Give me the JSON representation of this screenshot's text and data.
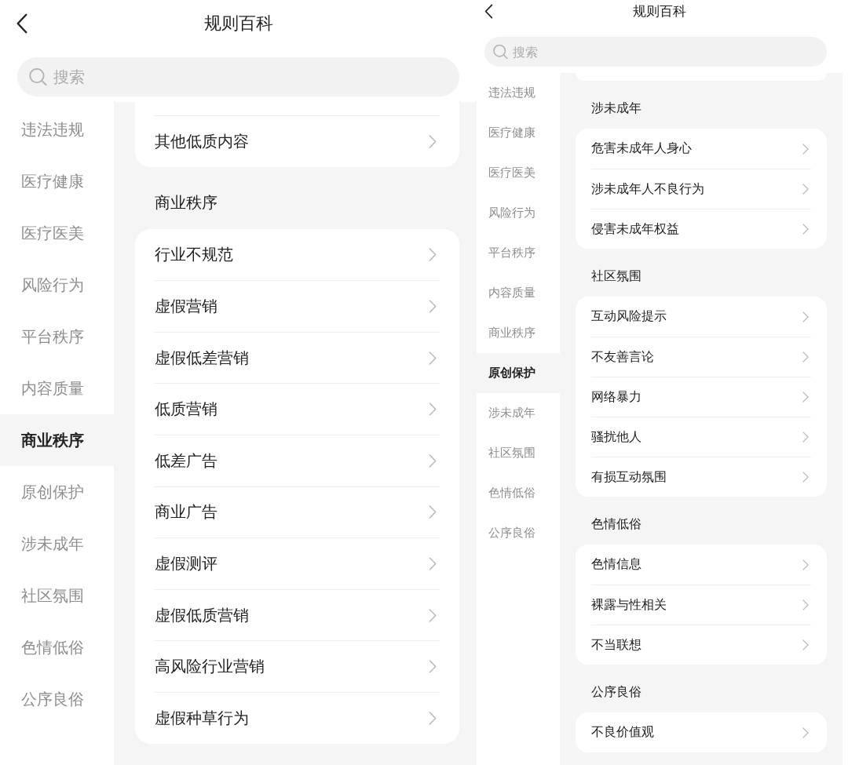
{
  "screens": [
    {
      "header": {
        "title": "规则百科"
      },
      "search": {
        "placeholder": "搜索"
      },
      "sidebar": {
        "items": [
          {
            "label": "违法违规",
            "selected": false
          },
          {
            "label": "医疗健康",
            "selected": false
          },
          {
            "label": "医疗医美",
            "selected": false
          },
          {
            "label": "风险行为",
            "selected": false
          },
          {
            "label": "平台秩序",
            "selected": false
          },
          {
            "label": "内容质量",
            "selected": false
          },
          {
            "label": "商业秩序",
            "selected": true
          },
          {
            "label": "原创保护",
            "selected": false
          },
          {
            "label": "涉未成年",
            "selected": false
          },
          {
            "label": "社区氛围",
            "selected": false
          },
          {
            "label": "色情低俗",
            "selected": false
          },
          {
            "label": "公序良俗",
            "selected": false
          }
        ]
      },
      "content": {
        "sections": [
          {
            "clipped": true,
            "items": [
              {
                "label": "其他低质内容"
              }
            ]
          },
          {
            "clipped": false,
            "title": "商业秩序",
            "items": [
              {
                "label": "行业不规范"
              },
              {
                "label": "虚假营销"
              },
              {
                "label": "虚假低差营销"
              },
              {
                "label": "低质营销"
              },
              {
                "label": "低差广告"
              },
              {
                "label": "商业广告"
              },
              {
                "label": "虚假测评"
              },
              {
                "label": "虚假低质营销"
              },
              {
                "label": "高风险行业营销"
              },
              {
                "label": "虚假种草行为"
              }
            ]
          }
        ]
      }
    },
    {
      "header": {
        "title": "规则百科"
      },
      "search": {
        "placeholder": "搜索"
      },
      "sidebar": {
        "items": [
          {
            "label": "违法违规",
            "selected": false
          },
          {
            "label": "医疗健康",
            "selected": false
          },
          {
            "label": "医疗医美",
            "selected": false
          },
          {
            "label": "风险行为",
            "selected": false
          },
          {
            "label": "平台秩序",
            "selected": false
          },
          {
            "label": "内容质量",
            "selected": false
          },
          {
            "label": "商业秩序",
            "selected": false
          },
          {
            "label": "原创保护",
            "selected": true
          },
          {
            "label": "涉未成年",
            "selected": false
          },
          {
            "label": "社区氛围",
            "selected": false
          },
          {
            "label": "色情低俗",
            "selected": false
          },
          {
            "label": "公序良俗",
            "selected": false
          }
        ]
      },
      "content": {
        "sections": [
          {
            "clipped": true
          },
          {
            "clipped": false,
            "title": "涉未成年",
            "items": [
              {
                "label": "危害未成年人身心"
              },
              {
                "label": "涉未成年人不良行为"
              },
              {
                "label": "侵害未成年权益"
              }
            ]
          },
          {
            "clipped": false,
            "title": "社区氛围",
            "items": [
              {
                "label": "互动风险提示"
              },
              {
                "label": "不友善言论"
              },
              {
                "label": "网络暴力"
              },
              {
                "label": "骚扰他人"
              },
              {
                "label": "有损互动氛围"
              }
            ]
          },
          {
            "clipped": false,
            "title": "色情低俗",
            "items": [
              {
                "label": "色情信息"
              },
              {
                "label": "裸露与性相关"
              },
              {
                "label": "不当联想"
              }
            ]
          },
          {
            "clipped": false,
            "title": "公序良俗",
            "items": [
              {
                "label": "不良价值观"
              }
            ]
          }
        ]
      }
    }
  ]
}
